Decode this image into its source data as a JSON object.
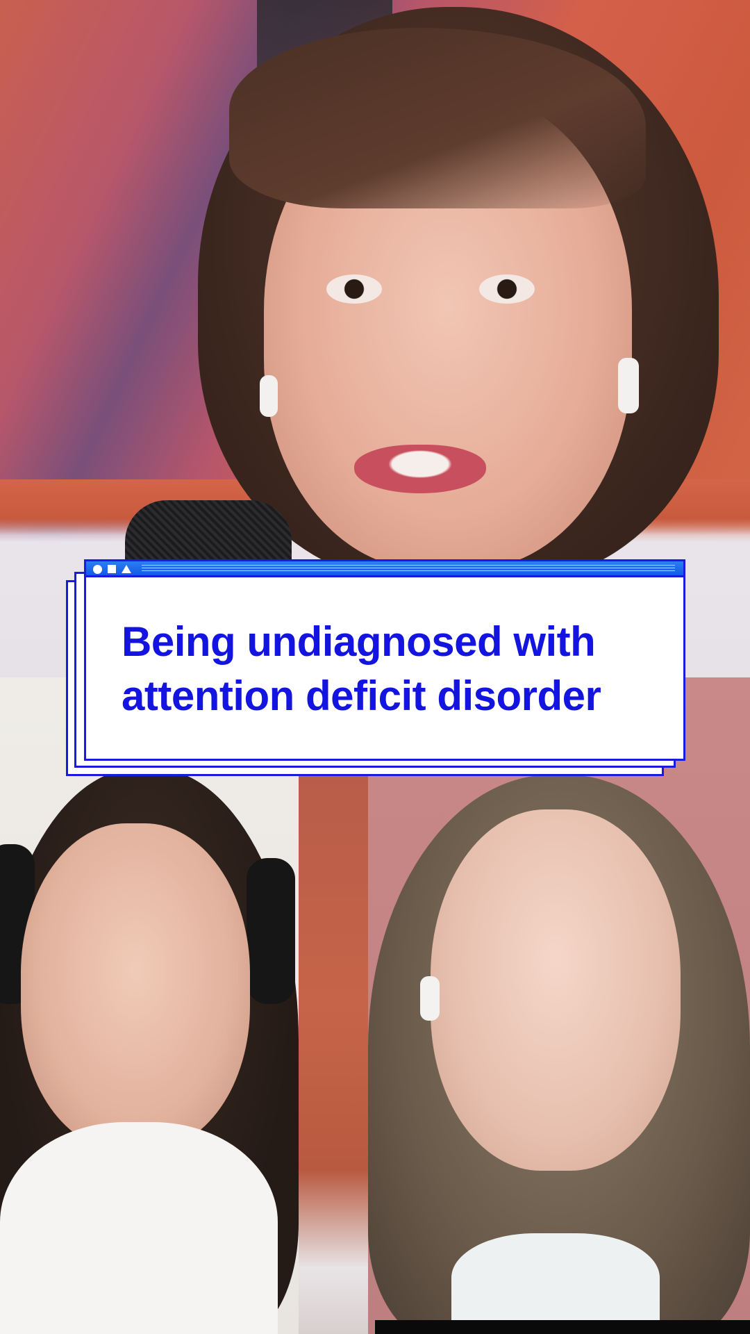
{
  "title_card": {
    "line1": "Being undiagnosed with",
    "line2": "attention deficit disorder",
    "text_color": "#1414e0",
    "titlebar_color": "#1459e8",
    "window_controls": [
      "circle-icon",
      "square-icon",
      "triangle-icon"
    ]
  },
  "participants": [
    {
      "role": "host",
      "position": "top"
    },
    {
      "role": "guest",
      "position": "bottom-left"
    },
    {
      "role": "guest",
      "position": "bottom-right"
    }
  ]
}
